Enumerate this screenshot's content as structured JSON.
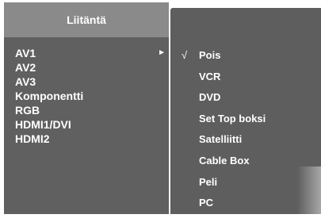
{
  "left_menu": {
    "title": "Liitäntä",
    "items": [
      {
        "label": "AV1",
        "has_submenu": true,
        "selected": true
      },
      {
        "label": "AV2"
      },
      {
        "label": "AV3"
      },
      {
        "label": "Komponentti"
      },
      {
        "label": "RGB"
      },
      {
        "label": "HDMI1/DVI"
      },
      {
        "label": "HDMI2"
      }
    ],
    "arrow_icon": "►"
  },
  "right_menu": {
    "check_icon": "√",
    "items": [
      {
        "label": "Pois",
        "checked": true
      },
      {
        "label": "VCR"
      },
      {
        "label": "DVD"
      },
      {
        "label": "Set Top boksi"
      },
      {
        "label": "Satelliitti"
      },
      {
        "label": "Cable Box"
      },
      {
        "label": "Peli"
      },
      {
        "label": "PC"
      }
    ]
  },
  "colors": {
    "left_panel": "#606060",
    "left_header": "#8a8a8a",
    "right_panel": "#5e5e5e",
    "text": "#ffffff"
  }
}
